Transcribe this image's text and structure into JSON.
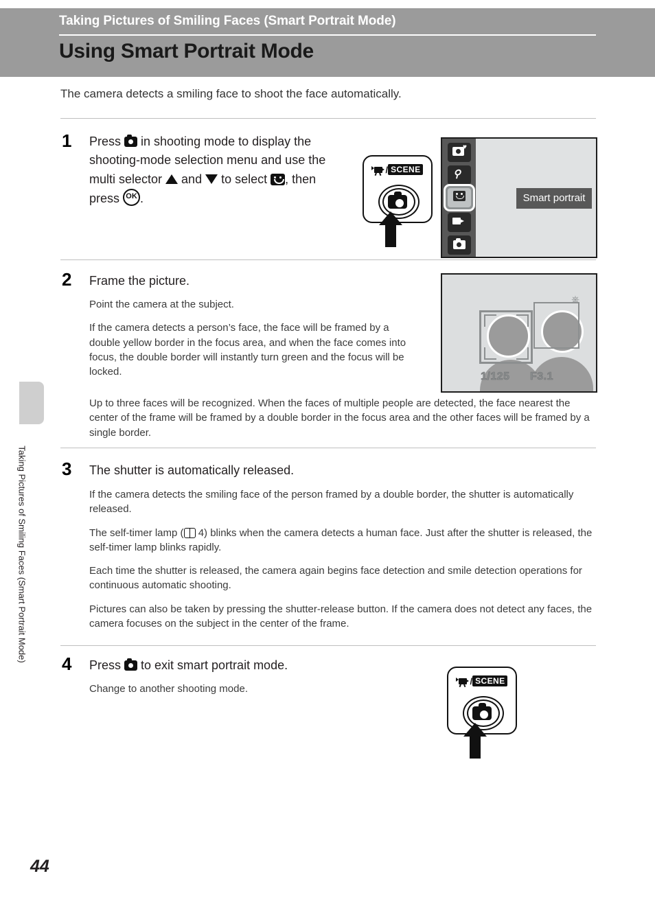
{
  "header": {
    "subtitle": "Taking Pictures of Smiling Faces (Smart Portrait Mode)",
    "title": "Using Smart Portrait Mode",
    "band_color": "#9b9b9b"
  },
  "side_tab_label": "Taking Pictures of Smiling Faces (Smart Portrait Mode)",
  "page_number": "44",
  "intro": "The camera detects a smiling face to shoot the face automatically.",
  "steps": [
    {
      "number": "1",
      "heading_parts": {
        "p1": "Press ",
        "p2": " in shooting mode to display the shooting-mode selection menu and use the multi selector ",
        "p3": " and ",
        "p4": " to select ",
        "p5": ", then press ",
        "p6": "."
      },
      "icons": [
        "camera-mode-icon",
        "multi-selector-up-icon",
        "multi-selector-down-icon",
        "smart-portrait-icon",
        "ok-button-icon"
      ]
    },
    {
      "number": "2",
      "heading": "Frame the picture.",
      "paragraphs": [
        "Point the camera at the subject.",
        "If the camera detects a person’s face, the face will be framed by a double yellow border in the focus area, and when the face comes into focus, the double border will instantly turn green and the focus will be locked.",
        "Up to three faces will be recognized. When the faces of multiple people are detected, the face nearest the center of the frame will be framed by a double border in the focus area and the other faces will be framed by a single border."
      ]
    },
    {
      "number": "3",
      "heading": "The shutter is automatically released.",
      "paragraphs": [
        "If the camera detects the smiling face of the person framed by a double border, the shutter is automatically released.",
        "Each time the shutter is released, the camera again begins face detection and smile detection operations for continuous automatic shooting.",
        "Pictures can also be taken by pressing the shutter-release button. If the camera does not detect any faces, the camera focuses on the subject in the center of the frame."
      ],
      "selftimer_parts": {
        "before": "The self-timer lamp (",
        "ref": " 4) blinks when the camera detects a human face. Just after the shutter is released, the self-timer lamp blinks rapidly."
      }
    },
    {
      "number": "4",
      "heading_parts": {
        "p1": "Press ",
        "p2": " to exit smart portrait mode."
      },
      "paragraph": "Change to another shooting mode."
    }
  ],
  "mode_button": {
    "label_movie": "movie-scene-icon",
    "label_separator": "/",
    "label_scene": "SCENE",
    "dial_icon": "camera-shooting-mode-icon"
  },
  "mode_menu": {
    "items": [
      {
        "name": "auto-with-heart-icon",
        "selected": false
      },
      {
        "name": "night-scene-icon",
        "selected": false
      },
      {
        "name": "smart-portrait-icon",
        "selected": true
      },
      {
        "name": "movie-mode-icon",
        "selected": false
      },
      {
        "name": "auto-mode-icon",
        "selected": false
      }
    ],
    "selected_label": "Smart portrait"
  },
  "lcd": {
    "shutter_speed": "1/125",
    "aperture": "F3.1",
    "faces": [
      {
        "border": "double",
        "position": "left"
      },
      {
        "border": "single",
        "position": "right"
      }
    ]
  }
}
